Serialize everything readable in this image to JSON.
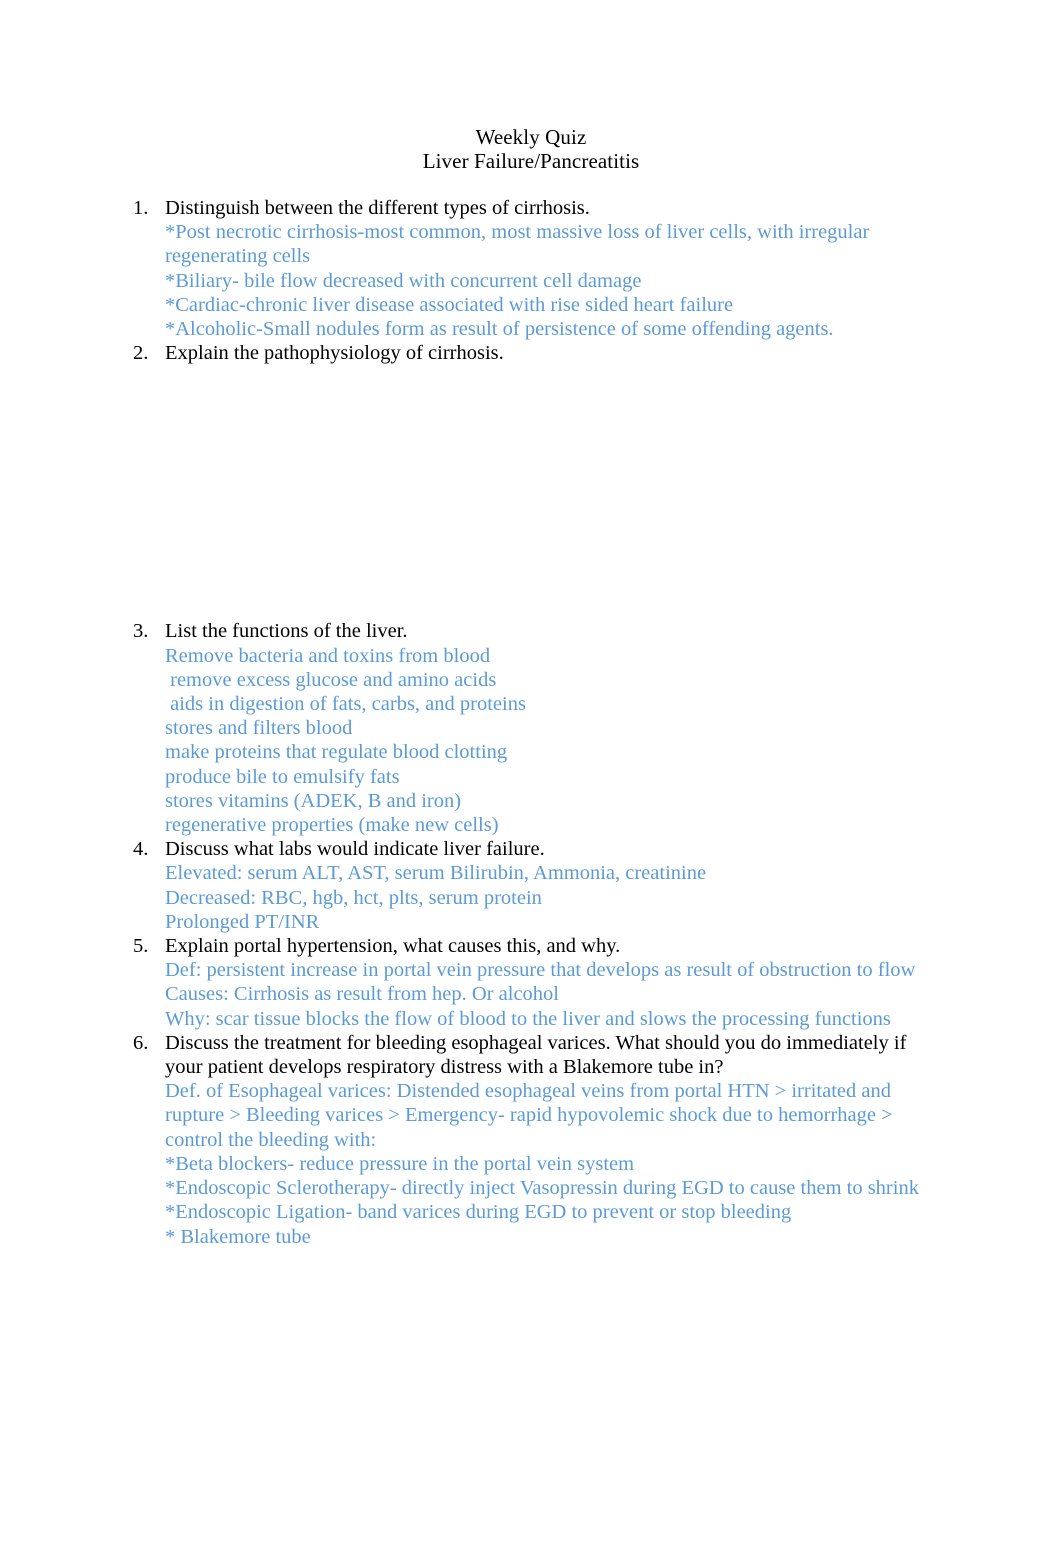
{
  "document": {
    "title_lines": [
      "Weekly Quiz",
      "Liver Failure/Pancreatitis"
    ],
    "answer_color": "#5b9bd5",
    "question_color": "#000000",
    "page_background": "#ffffff"
  },
  "questions": [
    {
      "number": "1.",
      "text": "Distinguish between the different types of cirrhosis.",
      "answers": [
        "*Post necrotic cirrhosis-most common, most massive loss of liver cells, with irregular regenerating cells",
        "*Biliary- bile flow decreased with concurrent cell damage",
        "*Cardiac-chronic liver disease associated with rise sided heart failure",
        "*Alcoholic-Small nodules form as result of persistence of some offending agents."
      ]
    },
    {
      "number": "2.",
      "text": "Explain the pathophysiology of cirrhosis.",
      "answers": []
    },
    {
      "number": "3.",
      "text": "List the functions of the liver.",
      "answers": [
        "Remove bacteria and toxins from blood",
        " remove excess glucose and amino acids",
        " aids in digestion of fats, carbs, and proteins",
        "stores and filters blood",
        "make proteins that regulate blood clotting",
        "produce bile to emulsify fats",
        "stores vitamins (ADEK, B and iron)",
        "regenerative properties (make new cells)"
      ]
    },
    {
      "number": "4.",
      "text": "Discuss what labs would indicate liver failure.",
      "answers": [
        "Elevated: serum ALT, AST, serum Bilirubin, Ammonia, creatinine",
        "Decreased: RBC, hgb, hct, plts, serum protein",
        "Prolonged PT/INR"
      ]
    },
    {
      "number": "5.",
      "text": "Explain portal hypertension, what causes this, and why.",
      "answers": [
        "Def: persistent increase in portal vein pressure that develops as result of obstruction to flow",
        "Causes: Cirrhosis as result from hep. Or alcohol",
        "Why: scar tissue blocks the flow of blood to the liver and slows the processing functions"
      ]
    },
    {
      "number": "6.",
      "text": "Discuss the treatment for bleeding esophageal varices. What should you do immediately if your patient develops respiratory distress with a Blakemore tube in?",
      "answers": [
        "Def. of Esophageal varices: Distended esophageal veins from portal HTN > irritated and rupture > Bleeding varices > Emergency- rapid hypovolemic shock due to hemorrhage > control the bleeding with:",
        "*Beta blockers- reduce pressure in the portal vein system",
        "*Endoscopic Sclerotherapy- directly inject Vasopressin during EGD to cause them to shrink",
        "*Endoscopic Ligation- band varices during EGD to prevent or stop bleeding",
        "* Blakemore tube"
      ]
    }
  ]
}
